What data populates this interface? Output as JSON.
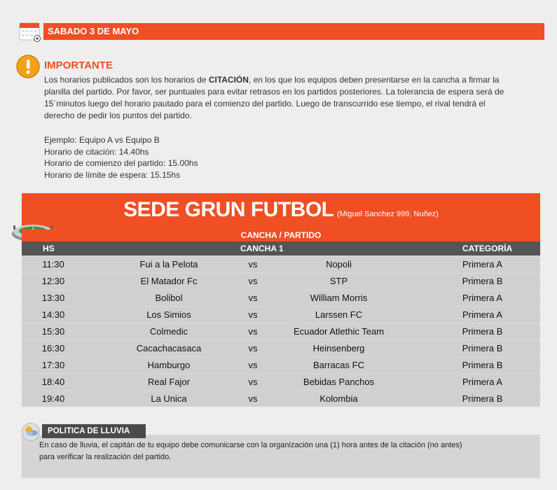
{
  "date_header": {
    "label": "SABADO 3 DE MAYO"
  },
  "importante": {
    "title": "IMPORTANTE",
    "text_before": "Los horarios publicados son los horarios de ",
    "text_bold": "CITACIÓN",
    "text_after": ", en los que los equipos deben presentarse en la cancha a firmar la planilla del partido. Por favor, ser puntuales para evitar retrasos en los partidos posteriores. La tolerancia de espera será de 15´minutos luego del horario pautado para el comienzo del partido. Luego de transcurrido ese tiempo, el rival tendrá el derecho de pedir los puntos del partido.",
    "example_lines": [
      "Ejemplo: Equipo A vs Equipo B",
      "Horario de citación: 14.40hs",
      "Horario de comienzo del partido: 15.00hs",
      "Horario de límite de espera: 15.15hs"
    ]
  },
  "sede": {
    "title": "SEDE GRUN FUTBOL",
    "address": "(Miguel Sanchez 999, Nuñez)",
    "subheader": "CANCHA / PARTIDO",
    "columns": {
      "hs": "HS",
      "cancha": "CANCHA 1",
      "categoria": "CATEGORÍA"
    },
    "matches": [
      {
        "hs": "11:30",
        "team1": "Fui a la Pelota",
        "vs": "vs",
        "team2": "Nopoli",
        "category": "Primera A"
      },
      {
        "hs": "12:30",
        "team1": "El Matador Fc",
        "vs": "vs",
        "team2": "STP",
        "category": "Primera B"
      },
      {
        "hs": "13:30",
        "team1": "Bolibol",
        "vs": "vs",
        "team2": "William Morris",
        "category": "Primera A"
      },
      {
        "hs": "14:30",
        "team1": "Los Simios",
        "vs": "vs",
        "team2": "Larssen FC",
        "category": "Primera A"
      },
      {
        "hs": "15:30",
        "team1": "Colmedic",
        "vs": "vs",
        "team2": "Ecuador Atlethic Team",
        "category": "Primera B"
      },
      {
        "hs": "16:30",
        "team1": "Cacachacasaca",
        "vs": "vs",
        "team2": "Heinsenberg",
        "category": "Primera B"
      },
      {
        "hs": "17:30",
        "team1": "Hamburgo",
        "vs": "vs",
        "team2": "Barracas FC",
        "category": "Primera B"
      },
      {
        "hs": "18:40",
        "team1": "Real Fajor",
        "vs": "vs",
        "team2": "Bebidas Panchos",
        "category": "Primera A"
      },
      {
        "hs": "19:40",
        "team1": "La Unica",
        "vs": "vs",
        "team2": "Kolombia",
        "category": "Primera B"
      }
    ]
  },
  "politica": {
    "title": "POLITICA DE LLUVIA",
    "lines": [
      "En caso de lluvia, el capitán de tu equipo debe comunicarse con la organización una (1) hora antes de la citación (no antes)",
      "para verificar la realización del partido."
    ]
  },
  "colors": {
    "accent": "#f04e23",
    "dark": "#4a4a4a",
    "row_bg": "#d0d0d0",
    "page_bg": "#eeeeee"
  },
  "icons": [
    "calendar-icon",
    "warning-icon",
    "stadium-icon",
    "rain-icon"
  ]
}
